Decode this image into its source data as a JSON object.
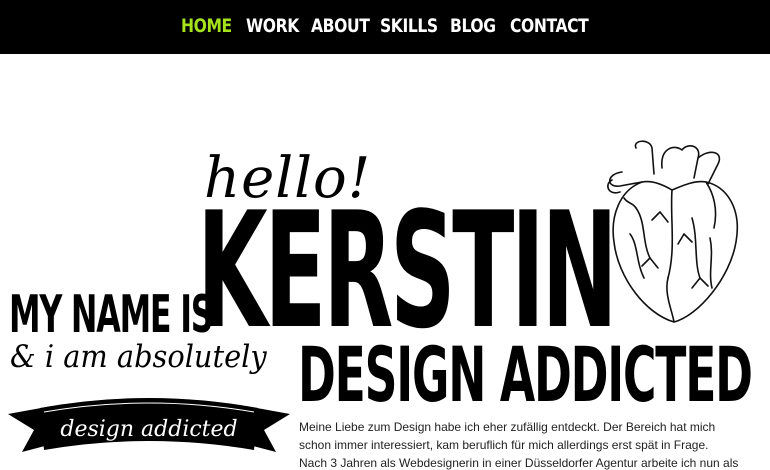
{
  "nav": {
    "items": [
      {
        "label": "HOME",
        "active": true
      },
      {
        "label": "WORK",
        "active": false
      },
      {
        "label": "ABOUT",
        "active": false
      },
      {
        "label": "SKILLS",
        "active": false
      },
      {
        "label": "BLOG",
        "active": false
      },
      {
        "label": "CONTACT",
        "active": false
      }
    ],
    "active_color": "#a5e31c",
    "background": "#000000"
  },
  "hero": {
    "greeting": "hello!",
    "name": "KERSTIN",
    "intro_prefix": "MY NAME IS",
    "tagline": "& i am absolutely",
    "headline": "DESIGN ADDICTED",
    "banner_text": "design addicted",
    "heart_image": "anatomical-heart-illustration"
  },
  "intro_text": {
    "lines": [
      "Meine Liebe zum Design habe ich eher zufällig entdeckt. Der Bereich hat mich",
      "schon immer interessiert, kam beruflich für mich allerdings erst spät in Frage.",
      "Nach 3 Jahren als Webdesignerin in einer Düsseldorfer Agentur arbeite ich nun als"
    ]
  }
}
